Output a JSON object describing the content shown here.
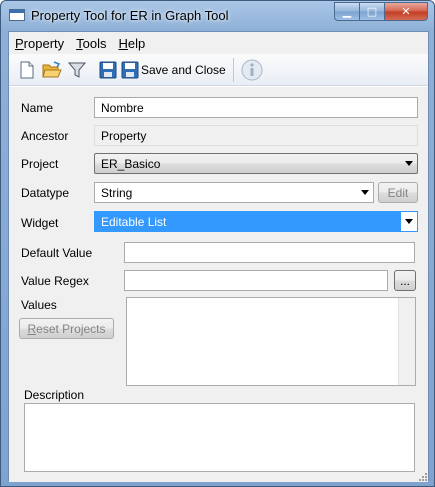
{
  "window": {
    "title": "Property Tool for ER in Graph Tool",
    "min_glyph": "▁",
    "max_glyph": "□",
    "close_glyph": "✕"
  },
  "menu": {
    "items": [
      {
        "label_first": "P",
        "label_rest": "roperty"
      },
      {
        "label_first": "T",
        "label_rest": "ools"
      },
      {
        "label_first": "H",
        "label_rest": "elp"
      }
    ]
  },
  "toolbar": {
    "icons": [
      "new-document-icon",
      "open-folder-icon",
      "filter-icon",
      "save-icon",
      "save-and-close-icon",
      "info-icon"
    ],
    "save_close_label": "Save and Close"
  },
  "form": {
    "name_label": "Name",
    "name_value": "Nombre",
    "ancestor_label": "Ancestor",
    "ancestor_value": "Property",
    "project_label": "Project",
    "project_value": "ER_Basico",
    "datatype_label": "Datatype",
    "datatype_value": "String",
    "edit_button": "Edit",
    "widget_label": "Widget",
    "widget_value": "Editable List",
    "default_value_label": "Default Value",
    "default_value": "",
    "value_regex_label": "Value Regex",
    "value_regex": "",
    "browse_button": "...",
    "values_label": "Values",
    "reset_projects_first": "R",
    "reset_projects_rest": "eset Projects",
    "description_label": "Description",
    "description_value": ""
  },
  "colors": {
    "selection": "#3399ff",
    "window_frame": "#8fb0d6",
    "client_bg": "#f0f0f0"
  }
}
